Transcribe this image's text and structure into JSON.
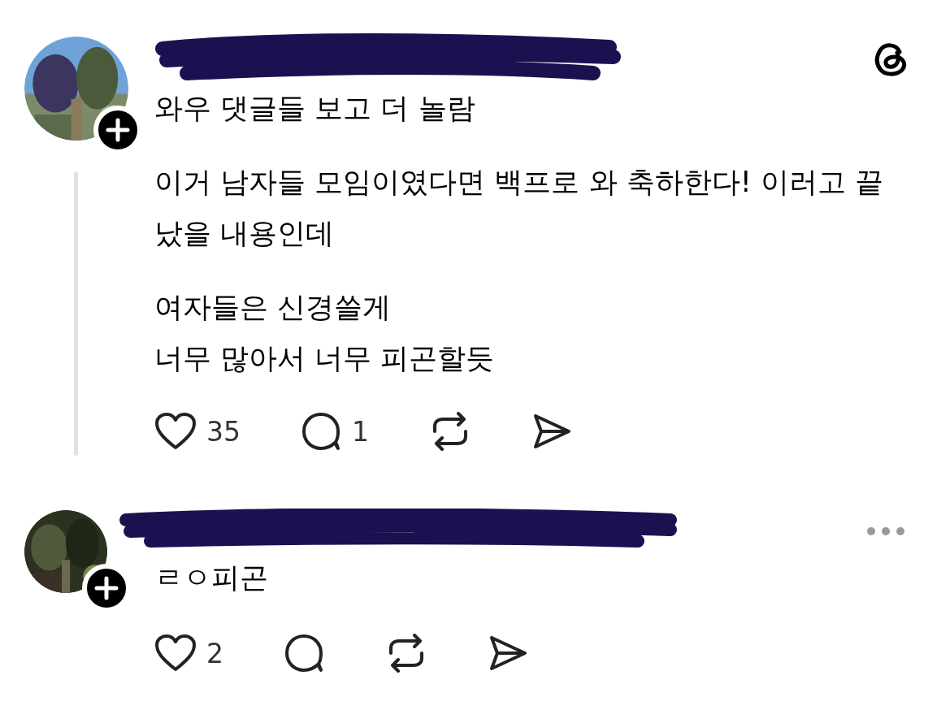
{
  "comments": [
    {
      "avatar": {
        "kind": "picture"
      },
      "username_redacted": true,
      "thread_line": true,
      "more_menu": false,
      "paragraphs": [
        "와우 댓글들 보고 더 놀람",
        "이거 남자들 모임이였다면 백프로 와 축하한다! 이러고 끝났을 내용인데",
        "여자들은 신경쓸게\n너무 많아서 너무 피곤할듯"
      ],
      "likes": "35",
      "replies": "1"
    },
    {
      "avatar": {
        "kind": "picture"
      },
      "username_redacted": true,
      "thread_line": false,
      "more_menu": true,
      "paragraphs": [
        "ㄹㅇ피곤"
      ],
      "likes": "2"
    }
  ]
}
